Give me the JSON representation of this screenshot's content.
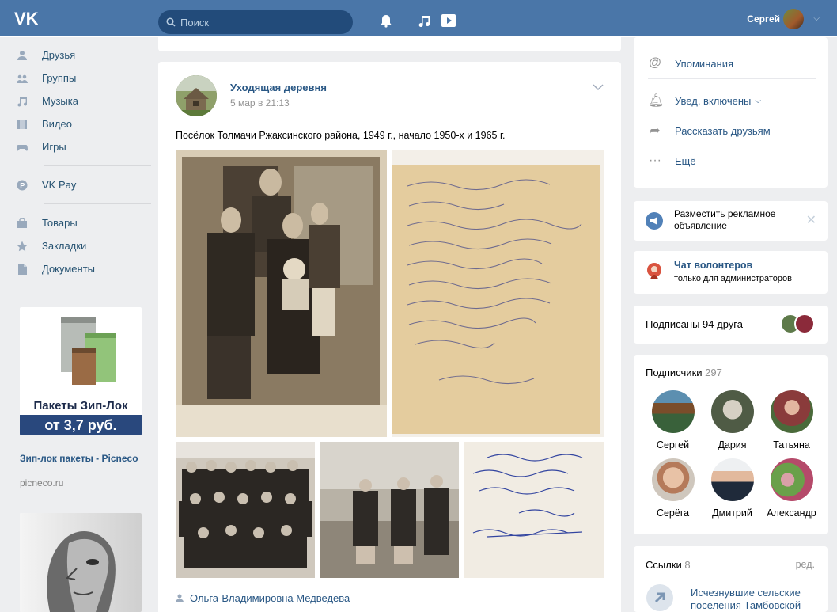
{
  "header": {
    "search_placeholder": "Поиск",
    "user_name": "Сергей"
  },
  "left_nav": {
    "items": [
      {
        "label": "Друзья",
        "icon": "friends-icon"
      },
      {
        "label": "Группы",
        "icon": "groups-icon"
      },
      {
        "label": "Музыка",
        "icon": "music-icon"
      },
      {
        "label": "Видео",
        "icon": "video-icon"
      },
      {
        "label": "Игры",
        "icon": "games-icon"
      },
      {
        "label": "VK Pay",
        "icon": "vkpay-icon"
      },
      {
        "label": "Товары",
        "icon": "goods-icon"
      },
      {
        "label": "Закладки",
        "icon": "bookmarks-icon"
      },
      {
        "label": "Документы",
        "icon": "documents-icon"
      }
    ],
    "ad1": {
      "banner_line1": "Пакеты Зип-Лок",
      "banner_line2": "от 3,7 руб.",
      "title": "Зип-лок пакеты - Picneco",
      "url": "picneco.ru"
    }
  },
  "post": {
    "author": "Уходящая деревня",
    "date": "5 мар в 21:13",
    "text": "Посёлок Толмачи Ржаксинского района, 1949 г., начало 1950-х и 1965 г.",
    "signed_by": "Ольга-Владимировна Медведева"
  },
  "right": {
    "menu": {
      "mentions": "Упоминания",
      "notifications": "Увед. включены",
      "share": "Рассказать друзьям",
      "more": "Ещё"
    },
    "ad_place": "Разместить рекламное объявление",
    "volunteer_chat": {
      "title": "Чат волонтеров",
      "subtitle": "только для администраторов"
    },
    "friends_subscribed": "Подписаны 94 друга",
    "subscribers": {
      "title": "Подписчики",
      "count": "297",
      "people": [
        "Сергей",
        "Дария",
        "Татьяна",
        "Серёга",
        "Дмитрий",
        "Александр"
      ]
    },
    "links": {
      "title": "Ссылки",
      "count": "8",
      "edit": "ред.",
      "first": "Исчезнувшие сельские поселения Тамбовской"
    }
  },
  "colors": {
    "header_bg": "#4a76a8",
    "link": "#2a5885",
    "page_bg": "#edeef0"
  }
}
